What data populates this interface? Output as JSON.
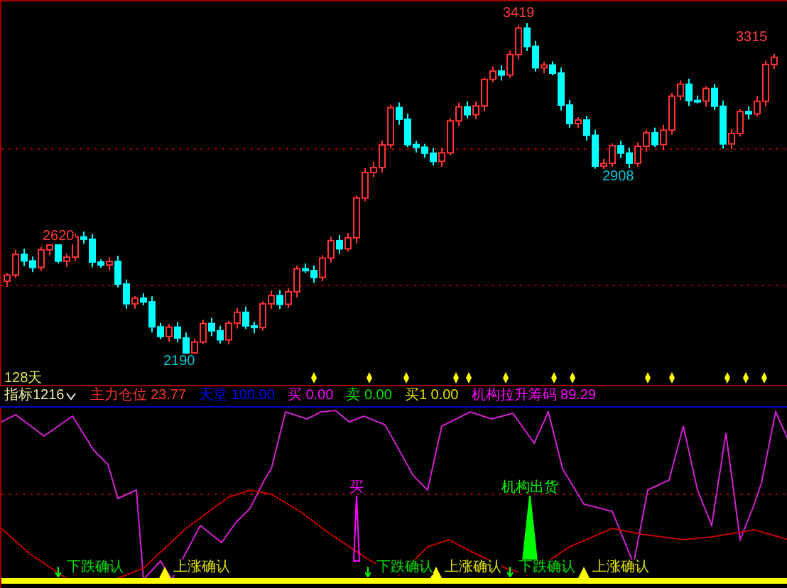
{
  "main_chart": {
    "period_label": "128天",
    "price_labels": [
      {
        "text": "2620",
        "kind": "high"
      },
      {
        "text": "2190",
        "kind": "low"
      },
      {
        "text": "3419",
        "kind": "high"
      },
      {
        "text": "2908",
        "kind": "low"
      },
      {
        "text": "3315",
        "kind": "high"
      }
    ]
  },
  "indicator_bar": {
    "selector": "指标1216",
    "readings": [
      {
        "label": "主力仓位",
        "value": "23.77",
        "color": "#ff3232"
      },
      {
        "label": "天堂",
        "value": "100.00",
        "color": "#0000ff"
      },
      {
        "label": "买",
        "value": "0.00",
        "color": "#ff00ff"
      },
      {
        "label": "卖",
        "value": "0.00",
        "color": "#00e000"
      },
      {
        "label": "买1",
        "value": "0.00",
        "color": "#e0e000"
      },
      {
        "label": "机构拉升筹码",
        "value": "89.29",
        "color": "#ff00ff"
      }
    ]
  },
  "lower_panel": {
    "markers": [
      {
        "text": "买",
        "kind": "buy"
      },
      {
        "text": "机构出货",
        "kind": "distribution"
      }
    ],
    "signals": [
      {
        "text": "下跌确认",
        "kind": "down"
      },
      {
        "text": "上涨确认",
        "kind": "up"
      },
      {
        "text": "下跌确认",
        "kind": "down"
      },
      {
        "text": "上涨确认",
        "kind": "up"
      },
      {
        "text": "下跌确认",
        "kind": "down"
      },
      {
        "text": "上涨确认",
        "kind": "up"
      }
    ]
  }
}
